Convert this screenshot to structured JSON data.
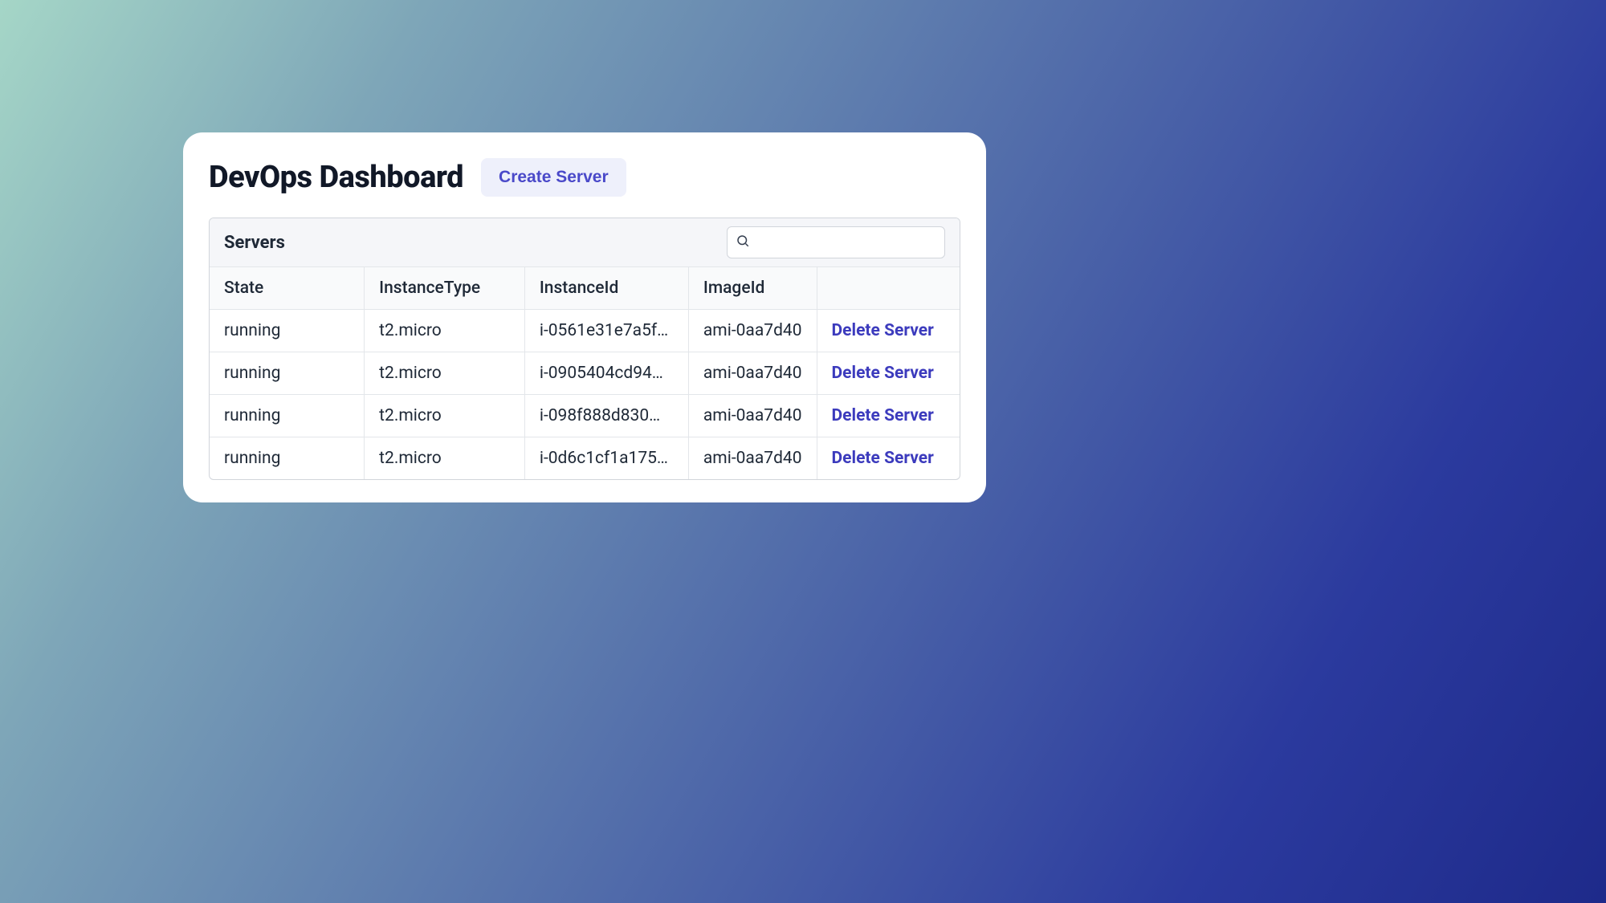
{
  "header": {
    "title": "DevOps Dashboard",
    "create_label": "Create Server"
  },
  "table": {
    "title": "Servers",
    "search_placeholder": "",
    "columns": {
      "state": "State",
      "instance_type": "InstanceType",
      "instance_id": "InstanceId",
      "image_id": "ImageId",
      "actions": ""
    },
    "delete_label": "Delete Server",
    "rows": [
      {
        "state": "running",
        "instance_type": "t2.micro",
        "instance_id": "i-0561e31e7a5f…",
        "image_id": "ami-0aa7d40"
      },
      {
        "state": "running",
        "instance_type": "t2.micro",
        "instance_id": "i-0905404cd94…",
        "image_id": "ami-0aa7d40"
      },
      {
        "state": "running",
        "instance_type": "t2.micro",
        "instance_id": "i-098f888d830…",
        "image_id": "ami-0aa7d40"
      },
      {
        "state": "running",
        "instance_type": "t2.micro",
        "instance_id": "i-0d6c1cf1a175…",
        "image_id": "ami-0aa7d40"
      }
    ]
  }
}
